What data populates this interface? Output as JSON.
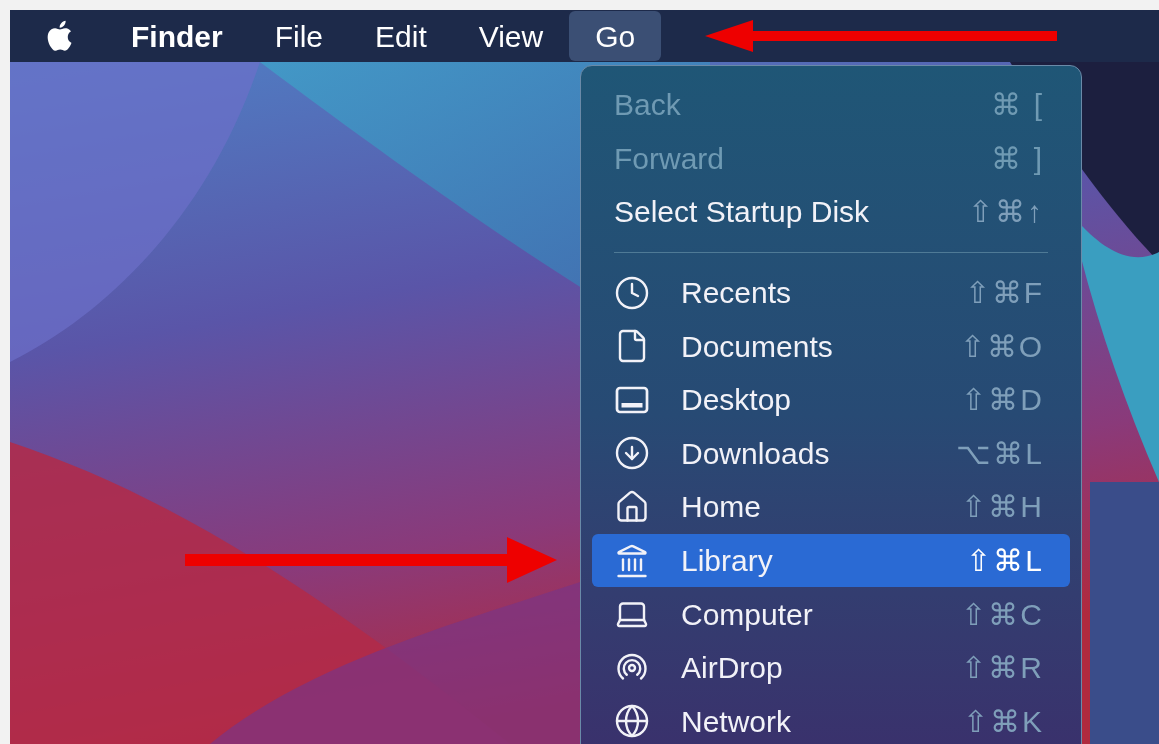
{
  "menu_bar": {
    "items": [
      {
        "label": "Finder",
        "kind": "app",
        "selected": false
      },
      {
        "label": "File",
        "kind": "menu",
        "selected": false
      },
      {
        "label": "Edit",
        "kind": "menu",
        "selected": false
      },
      {
        "label": "View",
        "kind": "menu",
        "selected": false
      },
      {
        "label": "Go",
        "kind": "menu",
        "selected": true
      }
    ]
  },
  "go_menu": {
    "sections": [
      {
        "items": [
          {
            "label": "Back",
            "shortcut": "⌘ [",
            "disabled": true,
            "selected": false
          },
          {
            "label": "Forward",
            "shortcut": "⌘ ]",
            "disabled": true,
            "selected": false
          },
          {
            "label": "Select Startup Disk",
            "shortcut": "⇧⌘↑",
            "disabled": false,
            "selected": false
          }
        ]
      },
      {
        "items": [
          {
            "label": "Recents",
            "shortcut": "⇧⌘F",
            "disabled": false,
            "selected": false
          },
          {
            "label": "Documents",
            "shortcut": "⇧⌘O",
            "disabled": false,
            "selected": false
          },
          {
            "label": "Desktop",
            "shortcut": "⇧⌘D",
            "disabled": false,
            "selected": false
          },
          {
            "label": "Downloads",
            "shortcut": "⌥⌘L",
            "disabled": false,
            "selected": false
          },
          {
            "label": "Home",
            "shortcut": "⇧⌘H",
            "disabled": false,
            "selected": false
          },
          {
            "label": "Library",
            "shortcut": "⇧⌘L",
            "disabled": false,
            "selected": true
          },
          {
            "label": "Computer",
            "shortcut": "⇧⌘C",
            "disabled": false,
            "selected": false
          },
          {
            "label": "AirDrop",
            "shortcut": "⇧⌘R",
            "disabled": false,
            "selected": false
          },
          {
            "label": "Network",
            "shortcut": "⇧⌘K",
            "disabled": false,
            "selected": false
          }
        ]
      }
    ]
  }
}
